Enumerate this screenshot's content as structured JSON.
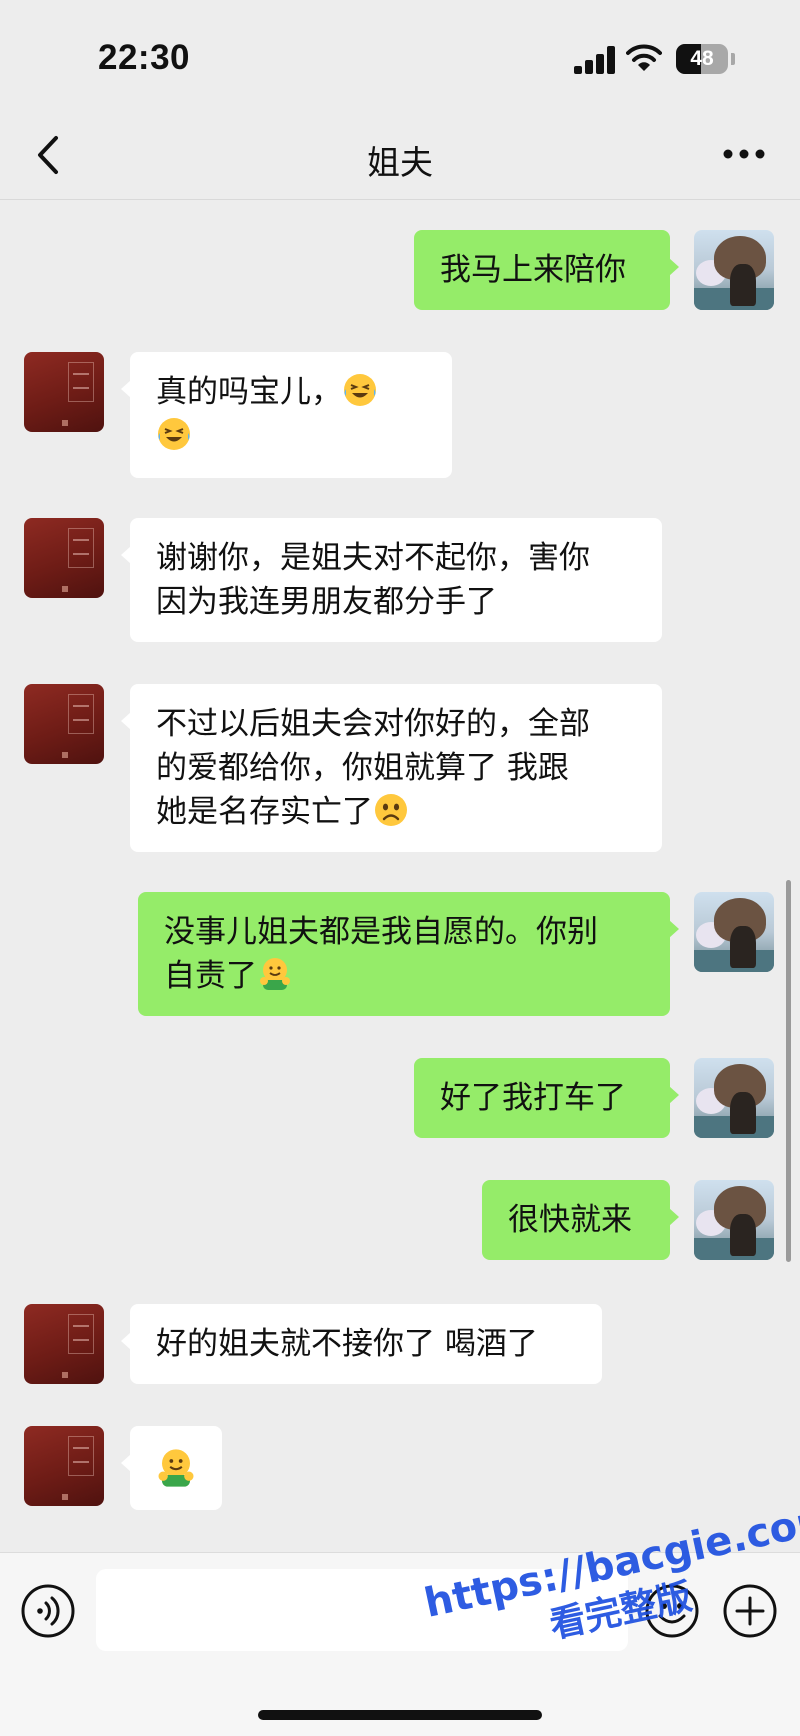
{
  "status_bar": {
    "time": "22:30",
    "battery_level": "48"
  },
  "nav": {
    "title": "姐夫"
  },
  "messages": [
    {
      "side": "sent",
      "text": "我马上来陪你"
    },
    {
      "side": "received",
      "text": "真的吗宝儿，",
      "emoji": [
        "grinning-squint-tears",
        "grinning-squint-tears"
      ]
    },
    {
      "side": "received",
      "text": "谢谢你，是姐夫对不起你，害你\n因为我连男朋友都分手了"
    },
    {
      "side": "received",
      "text": "不过以后姐夫会对你好的，全部\n的爱都给你，你姐就算了 我跟\n她是名存实亡了",
      "emoji": [
        "frowning-face"
      ]
    },
    {
      "side": "sent",
      "text": "没事儿姐夫都是我自愿的。你别\n自责了",
      "emoji": [
        "hug-face"
      ]
    },
    {
      "side": "sent",
      "text": "好了我打车了"
    },
    {
      "side": "sent",
      "text": "很快就来"
    },
    {
      "side": "received",
      "text": "好的姐夫就不接你了 喝酒了"
    },
    {
      "side": "received",
      "text": "",
      "emoji": [
        "hug-face"
      ]
    }
  ],
  "input": {
    "placeholder": ""
  },
  "watermark": {
    "line1": "https://bacgie.com",
    "line2": "看完整版"
  },
  "colors": {
    "sent_bubble": "#95ec69",
    "received_bubble": "#ffffff",
    "background": "#ededed",
    "watermark": "#1d4fe0"
  },
  "icons": [
    "back-icon",
    "more-icon",
    "voice-icon",
    "emoji-icon",
    "plus-icon",
    "signal-icon",
    "wifi-icon",
    "battery-icon"
  ]
}
